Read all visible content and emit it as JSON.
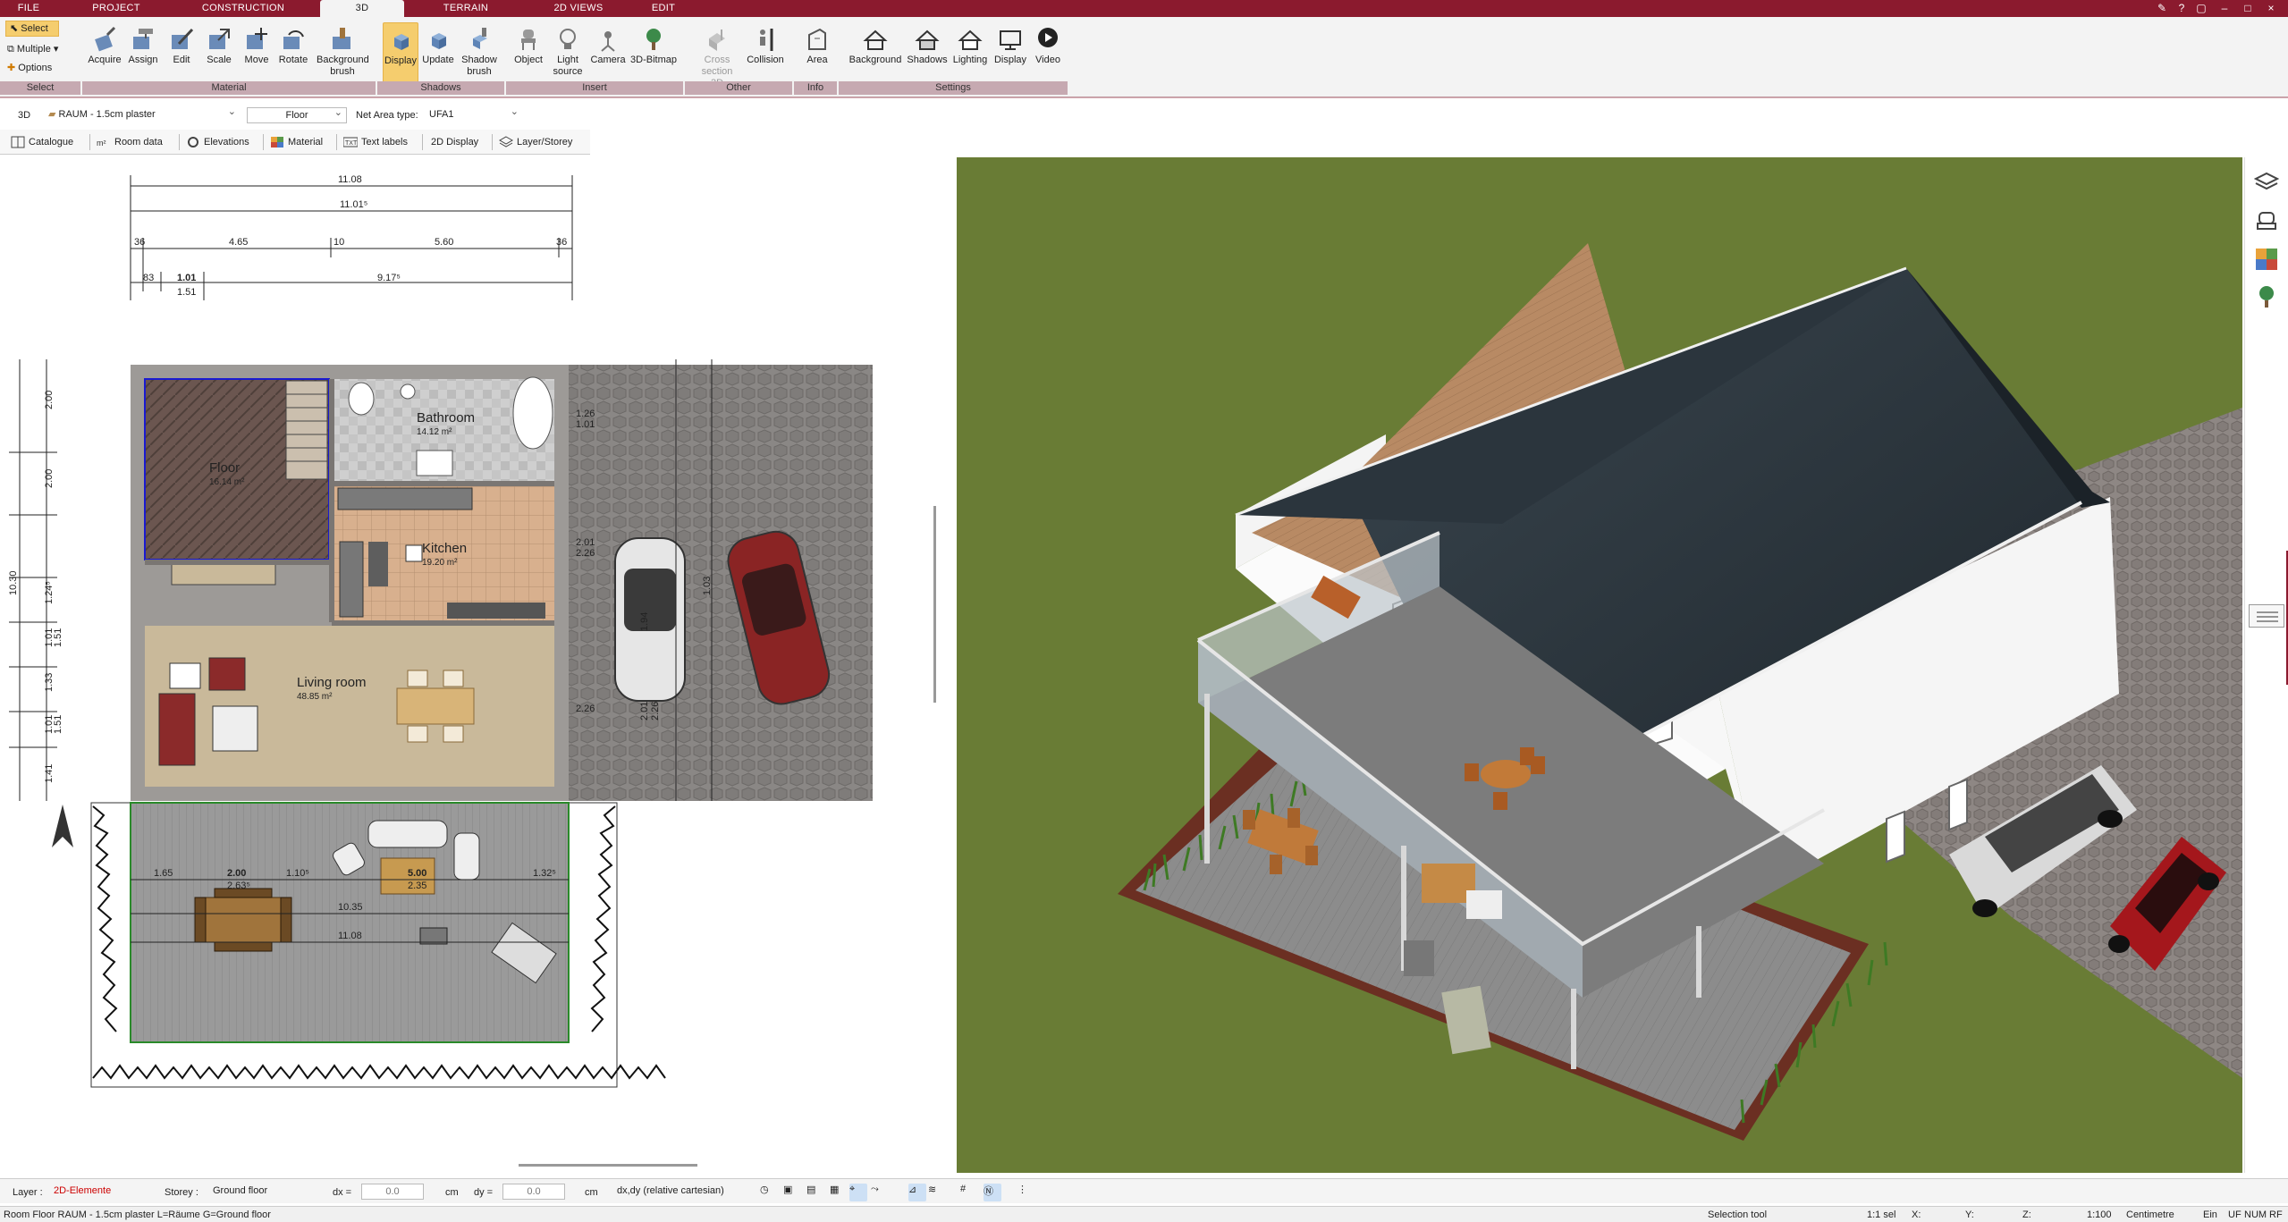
{
  "menu": {
    "tabs": [
      "FILE",
      "PROJECT",
      "CONSTRUCTION",
      "3D",
      "TERRAIN",
      "2D VIEWS",
      "EDIT"
    ],
    "active": "3D"
  },
  "ribbon": {
    "select": {
      "select_label": "Select",
      "multiple_label": "Multiple",
      "options_label": "Options"
    },
    "material": {
      "acquire": "Acquire",
      "assign": "Assign",
      "edit": "Edit",
      "scale": "Scale",
      "move": "Move",
      "rotate": "Rotate",
      "background_brush": "Background brush"
    },
    "shadows": {
      "display": "Display",
      "update": "Update",
      "shadow_brush": "Shadow brush"
    },
    "insert": {
      "object": "Object",
      "light_source": "Light source",
      "camera": "Camera",
      "bitmap_3d": "3D-Bitmap"
    },
    "other": {
      "cross_section": "Cross section 3D",
      "collision": "Collision"
    },
    "info": {
      "area": "Area"
    },
    "settings": {
      "background": "Background",
      "shadows": "Shadows",
      "lighting": "Lighting",
      "display": "Display",
      "video": "Video"
    },
    "groups": {
      "select": "Select",
      "material": "Material",
      "shadows": "Shadows",
      "insert": "Insert",
      "other": "Other",
      "info": "Info",
      "settings": "Settings"
    }
  },
  "propbar": {
    "mode": "3D",
    "room": "RAUM - 1.5cm plaster",
    "room_name": "Floor",
    "net_area_label": "Net Area type:",
    "net_area_value": "UFA1"
  },
  "viewtabs": {
    "catalogue": "Catalogue",
    "room_data": "Room data",
    "elevations": "Elevations",
    "material": "Material",
    "text_labels": "Text labels",
    "display_2d": "2D  Display",
    "layer_storey": "Layer/Storey"
  },
  "plan": {
    "rooms": [
      {
        "name": "Bathroom",
        "area": "14.12 m²"
      },
      {
        "name": "Floor",
        "area": "16.14 m²"
      },
      {
        "name": "Kitchen",
        "area": "19.20 m²"
      },
      {
        "name": "Living room",
        "area": "48.85 m²"
      }
    ],
    "dims_top": [
      "11.08",
      "11.01⁵",
      "4.65",
      "5.60",
      "36",
      "10",
      "36",
      "1.01",
      "9.17⁵",
      "1.51",
      "83"
    ],
    "dims_left": [
      "2.00",
      "2.00",
      "10.30",
      "1.24⁵",
      "1.01",
      "1.51",
      "1.33",
      "1.01",
      "1.51",
      "1.41"
    ],
    "dims_terrace": [
      "1.65",
      "2.00",
      "2.63⁵",
      "1.10⁵",
      "5.00",
      "2.35",
      "1.32⁵",
      "10.35",
      "11.08"
    ],
    "dims_right": [
      "1.26",
      "1.01",
      "2.26",
      "2.01",
      "2.26",
      "1.94",
      "2.01",
      "2.26",
      "1.03"
    ]
  },
  "layerbar": {
    "layer_label": "Layer :",
    "layer_value": "2D-Elemente",
    "storey_label": "Storey :",
    "storey_value": "Ground floor",
    "dx_label": "dx =",
    "dx_value": "0.0",
    "dx_unit": "cm",
    "dy_label": "dy =",
    "dy_value": "0.0",
    "dy_unit": "cm",
    "coord_mode": "dx,dy (relative cartesian)"
  },
  "statusbar": {
    "info": "Room Floor RAUM - 1.5cm plaster L=Räume G=Ground floor",
    "tool": "Selection tool",
    "sel": "1:1 sel",
    "x": "X:",
    "y": "Y:",
    "z": "Z:",
    "scale": "1:100",
    "unit": "Centimetre",
    "ein": "Ein",
    "uf": "UF",
    "num": "NUM",
    "rf": "RF"
  },
  "colors": {
    "brand": "#8b1a2e",
    "active": "#f5cd6e",
    "grass": "#667a34",
    "roof": "#28323a"
  }
}
